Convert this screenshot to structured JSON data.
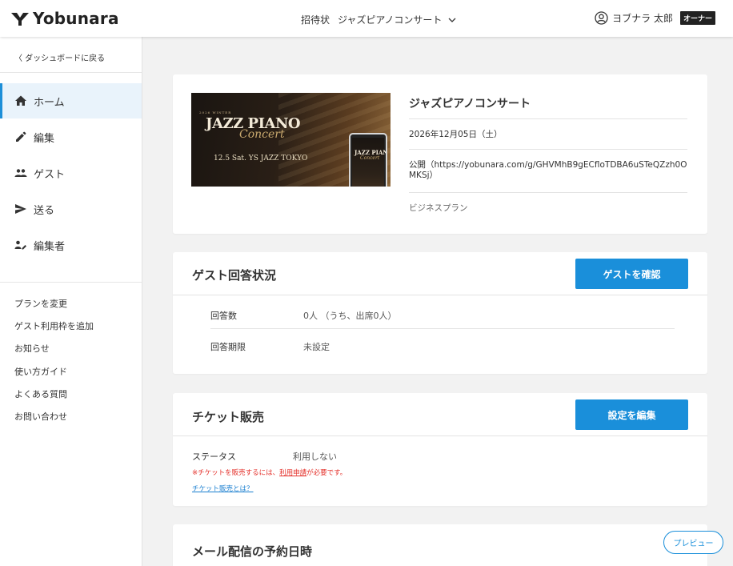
{
  "header": {
    "logo_text": "Yobunara",
    "nav_invitation": "招待状",
    "event_selector": "ジャズピアノコンサート",
    "user_name": "ヨブナラ 太郎",
    "role_badge": "オーナー"
  },
  "sidebar": {
    "back_link": "〈 ダッシュボードに戻る",
    "nav": [
      {
        "label": "ホーム",
        "icon": "home-icon",
        "active": true
      },
      {
        "label": "編集",
        "icon": "pencil-icon"
      },
      {
        "label": "ゲスト",
        "icon": "people-icon"
      },
      {
        "label": "送る",
        "icon": "send-icon"
      },
      {
        "label": "編集者",
        "icon": "editor-icon"
      }
    ],
    "links": [
      "プランを変更",
      "ゲスト利用枠を追加",
      "お知らせ",
      "使い方ガイド",
      "よくある質問",
      "お問い合わせ"
    ]
  },
  "event": {
    "image": {
      "small_text": "2026 WINTER",
      "title": "JAZZ PIANO",
      "script": "Concert",
      "date": "12.5 Sat. YS JAZZ TOKYO"
    },
    "title": "ジャズピアノコンサート",
    "date": "2026年12月05日（土）",
    "url": "公開（https://yobunara.com/g/GHVMhB9gECfloTDBA6uSTeQZzh0OMKSj）",
    "plan": "ビジネスプラン"
  },
  "guest_status": {
    "title": "ゲスト回答状況",
    "button": "ゲストを確認",
    "rows": [
      {
        "label": "回答数",
        "value": "0人 （うち、出席0人）"
      },
      {
        "label": "回答期限",
        "value": "未設定"
      }
    ]
  },
  "ticket": {
    "title": "チケット販売",
    "button": "設定を編集",
    "status_label": "ステータス",
    "status_value": "利用しない",
    "note_pre": "※チケットを販売するには、",
    "note_link": "利用申請",
    "note_post": "が必要です。",
    "help_link": "チケット販売とは？"
  },
  "mail": {
    "title": "メール配信の予約日時"
  },
  "preview_button": "プレビュー",
  "colors": {
    "accent": "#1a8fda",
    "active_bg": "#e9f3fb",
    "warning": "#e4312b",
    "page_bg": "#f2f2f2"
  }
}
